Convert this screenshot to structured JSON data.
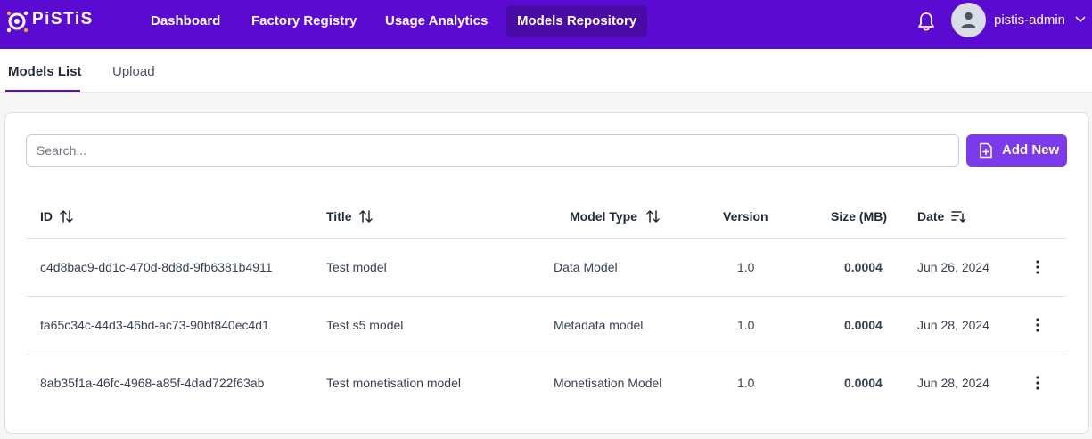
{
  "brand": {
    "name": "PiSTiS",
    "accent": "#5b0ad1",
    "button": "#7c3aed"
  },
  "nav": {
    "items": [
      {
        "label": "Dashboard",
        "active": false
      },
      {
        "label": "Factory Registry",
        "active": false
      },
      {
        "label": "Usage Analytics",
        "active": false
      },
      {
        "label": "Models Repository",
        "active": true
      }
    ],
    "notification_icon": "bell-icon",
    "user": {
      "name": "pistis-admin",
      "avatar_icon": "user-icon",
      "menu_icon": "chevron-down-icon"
    }
  },
  "tabs": [
    {
      "label": "Models List",
      "active": true
    },
    {
      "label": "Upload",
      "active": false
    }
  ],
  "toolbar": {
    "search_placeholder": "Search...",
    "search_value": "",
    "add_label": "Add New",
    "add_icon": "file-plus-icon"
  },
  "table": {
    "columns": [
      {
        "label": "ID",
        "sort_icon": "sort-arrows-icon"
      },
      {
        "label": "Title",
        "sort_icon": "sort-arrows-icon"
      },
      {
        "label": "Model Type",
        "sort_icon": "sort-arrows-icon"
      },
      {
        "label": "Version"
      },
      {
        "label": "Size (MB)"
      },
      {
        "label": "Date",
        "sort_icon": "sort-desc-icon"
      }
    ],
    "rows": [
      {
        "id": "c4d8bac9-dd1c-470d-8d8d-9fb6381b4911",
        "title": "Test model",
        "type": "Data Model",
        "version": "1.0",
        "size": "0.0004",
        "date": "Jun 26, 2024"
      },
      {
        "id": "fa65c34c-44d3-46bd-ac73-90bf840ec4d1",
        "title": "Test s5 model",
        "type": "Metadata model",
        "version": "1.0",
        "size": "0.0004",
        "date": "Jun 28, 2024"
      },
      {
        "id": "8ab35f1a-46fc-4968-a85f-4dad722f63ab",
        "title": "Test monetisation model",
        "type": "Monetisation Model",
        "version": "1.0",
        "size": "0.0004",
        "date": "Jun 28, 2024"
      }
    ],
    "row_action_icon": "more-vertical-icon"
  }
}
